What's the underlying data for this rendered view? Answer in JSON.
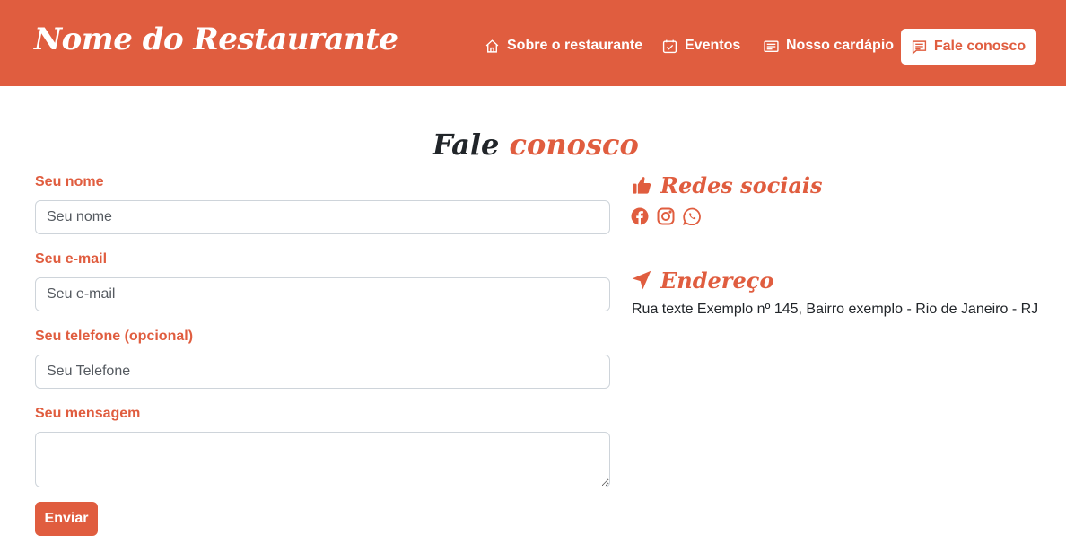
{
  "header": {
    "brand": "Nome do Restaurante",
    "nav": [
      {
        "label": "Sobre o restaurante",
        "icon": "house-icon"
      },
      {
        "label": "Eventos",
        "icon": "calendar-check-icon"
      },
      {
        "label": "Nosso cardápio",
        "icon": "card-text-icon"
      },
      {
        "label": "Fale conosco",
        "icon": "chat-text-icon",
        "active": true
      }
    ]
  },
  "page": {
    "title_part1": "Fale",
    "title_part2": "conosco"
  },
  "form": {
    "name_label": "Seu nome",
    "name_placeholder": "Seu nome",
    "email_label": "Seu e-mail",
    "email_placeholder": "Seu e-mail",
    "phone_label": "Seu telefone (opcional)",
    "phone_placeholder": "Seu Telefone",
    "message_label": "Seu mensagem",
    "submit_label": "Enviar"
  },
  "sidebar": {
    "social_heading": "Redes sociais",
    "social_icons": [
      "facebook-icon",
      "instagram-icon",
      "whatsapp-icon"
    ],
    "address_heading": "Endereço",
    "address_text": "Rua texte Exemplo nº 145, Bairro exemplo - Rio de Janeiro - RJ"
  },
  "colors": {
    "accent": "#e05d3f",
    "text": "#212529",
    "background": "#ffffff"
  }
}
